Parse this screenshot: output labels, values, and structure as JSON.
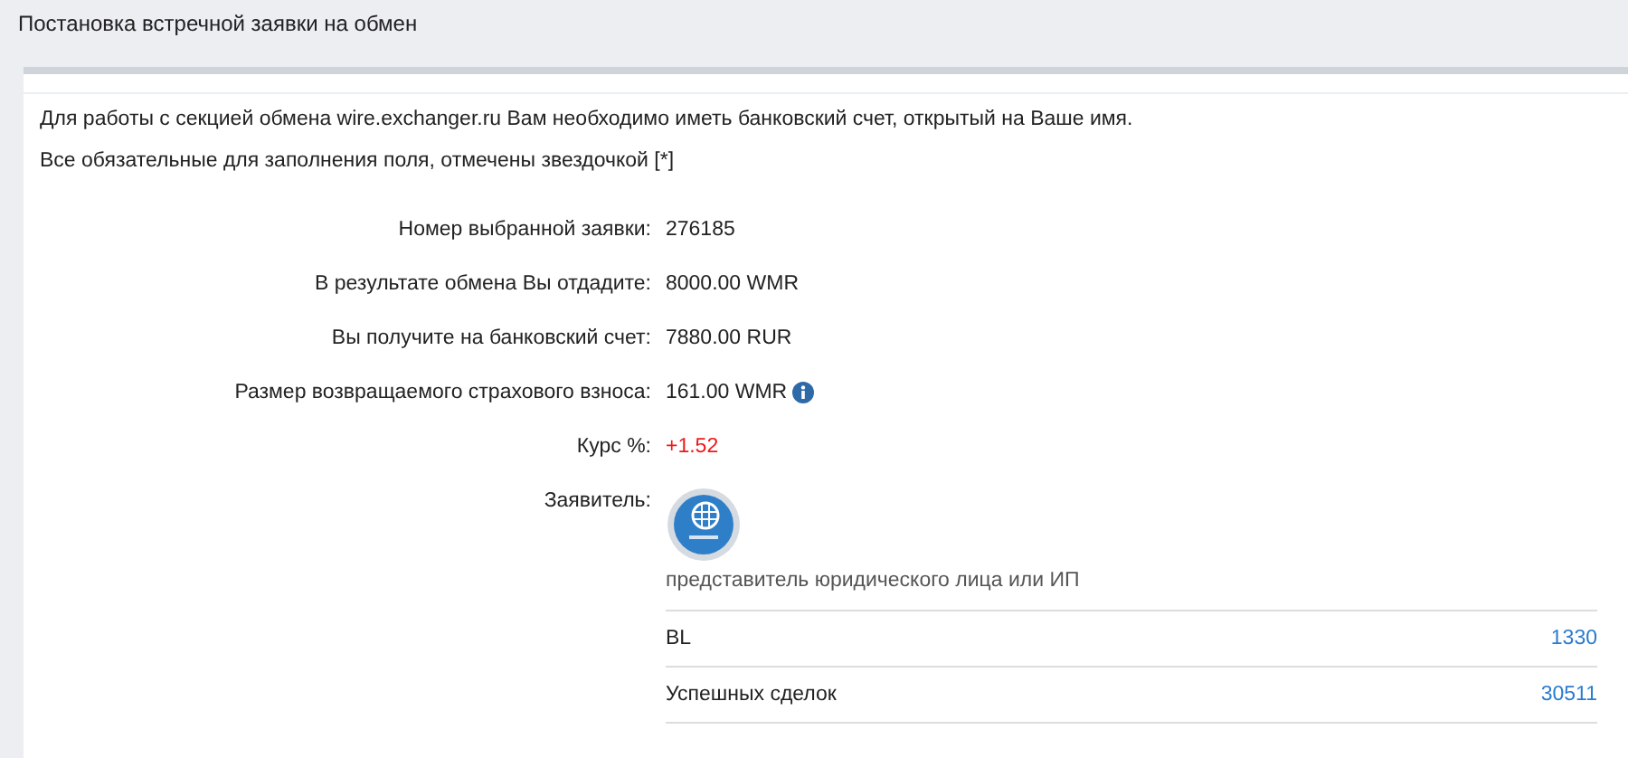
{
  "header": {
    "title": "Постановка встречной заявки на обмен"
  },
  "notes": [
    "Для работы с секцией обмена wire.exchanger.ru Вам необходимо иметь банковский счет, открытый на Ваше имя.",
    "Все обязательные для заполнения поля, отмечены звездочкой [*]"
  ],
  "fields": [
    {
      "label": "Номер выбранной заявки:",
      "value": "276185",
      "kind": "plain",
      "info": false
    },
    {
      "label": "В результате обмена Вы отдадите:",
      "value": "8000.00 WMR",
      "kind": "plain",
      "info": false
    },
    {
      "label": "Вы получите на банковский счет:",
      "value": "7880.00 RUR",
      "kind": "plain",
      "info": false
    },
    {
      "label": "Размер возвращаемого страхового взноса:",
      "value": "161.00 WMR",
      "kind": "plain",
      "info": true
    },
    {
      "label": "Курс %:",
      "value": "+1.52",
      "kind": "rate",
      "info": false
    }
  ],
  "applicant": {
    "label": "Заявитель:",
    "status": "представитель юридического лица или ИП",
    "stats": [
      {
        "label": "BL",
        "value": "1330"
      },
      {
        "label": "Успешных сделок",
        "value": "30511"
      }
    ]
  }
}
